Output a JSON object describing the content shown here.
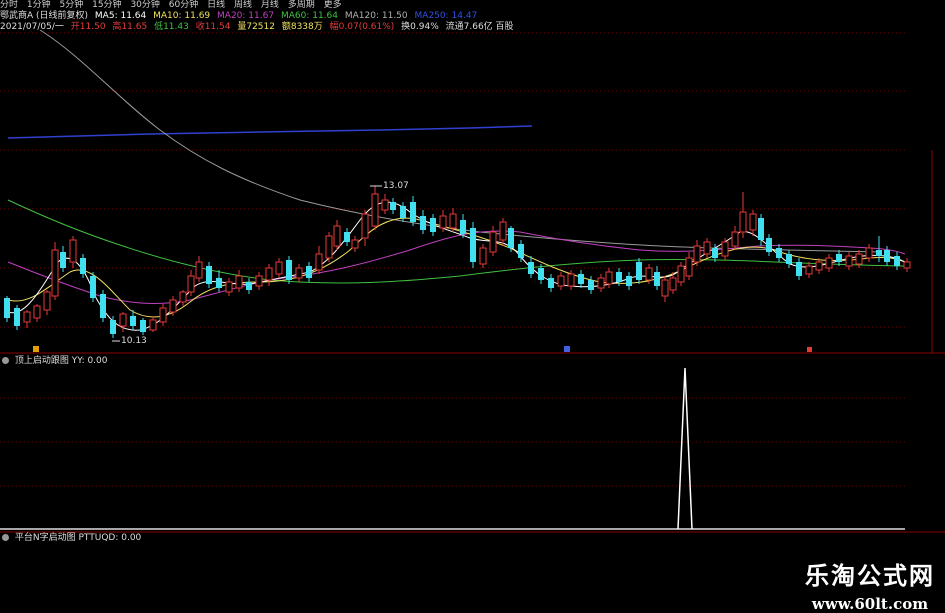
{
  "toolbar": {
    "items": [
      "分时",
      "1分钟",
      "5分钟",
      "15分钟",
      "30分钟",
      "60分钟",
      "日线",
      "周线",
      "月线",
      "多周期",
      "更多"
    ]
  },
  "header": {
    "stock_name": "鄂武商A (日线前复权)",
    "ma5": "MA5: 11.64",
    "ma10": "MA10: 11.69",
    "ma20": "MA20: 11.67",
    "ma60": "MA60: 11.64",
    "ma120": "MA120: 11.50",
    "ma250": "MA250: 14.47"
  },
  "quote": {
    "date": "2021/07/05/一",
    "open": "开11.50",
    "high": "高11.65",
    "low": "低11.43",
    "close": "收11.54",
    "volume": "量72512",
    "amount": "额8338万",
    "change": "幅0.07(0.61%)",
    "turnover": "换0.94%",
    "float": "流通7.66亿 百股"
  },
  "annotations": {
    "high_price": "13.07",
    "low_price": "10.13"
  },
  "indicator1": {
    "title": "顶上启动跟图",
    "value": "YY: 0.00"
  },
  "indicator2": {
    "title": "平台N字启动图",
    "value": "PTTUQD: 0.00"
  },
  "watermark": {
    "name": "乐淘公式网",
    "url": "www.60lt.com"
  },
  "colors": {
    "up": "#e63a3a",
    "down": "#40e0f0",
    "ma5": "#ffffff",
    "ma10": "#f0e060",
    "ma20": "#c040c0",
    "ma60": "#40c040",
    "ma120": "#9a9a9a",
    "ma250": "#3040d0",
    "grid": "#6a0000"
  }
}
